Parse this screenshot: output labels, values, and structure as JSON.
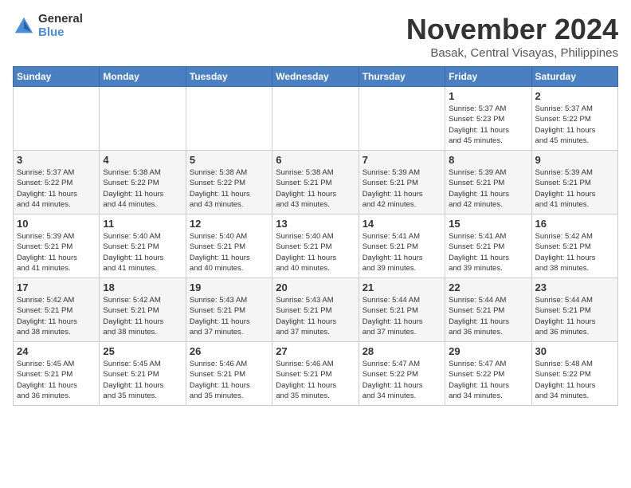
{
  "logo": {
    "general": "General",
    "blue": "Blue"
  },
  "title": "November 2024",
  "location": "Basak, Central Visayas, Philippines",
  "weekdays": [
    "Sunday",
    "Monday",
    "Tuesday",
    "Wednesday",
    "Thursday",
    "Friday",
    "Saturday"
  ],
  "weeks": [
    [
      {
        "day": "",
        "info": ""
      },
      {
        "day": "",
        "info": ""
      },
      {
        "day": "",
        "info": ""
      },
      {
        "day": "",
        "info": ""
      },
      {
        "day": "",
        "info": ""
      },
      {
        "day": "1",
        "info": "Sunrise: 5:37 AM\nSunset: 5:23 PM\nDaylight: 11 hours\nand 45 minutes."
      },
      {
        "day": "2",
        "info": "Sunrise: 5:37 AM\nSunset: 5:22 PM\nDaylight: 11 hours\nand 45 minutes."
      }
    ],
    [
      {
        "day": "3",
        "info": "Sunrise: 5:37 AM\nSunset: 5:22 PM\nDaylight: 11 hours\nand 44 minutes."
      },
      {
        "day": "4",
        "info": "Sunrise: 5:38 AM\nSunset: 5:22 PM\nDaylight: 11 hours\nand 44 minutes."
      },
      {
        "day": "5",
        "info": "Sunrise: 5:38 AM\nSunset: 5:22 PM\nDaylight: 11 hours\nand 43 minutes."
      },
      {
        "day": "6",
        "info": "Sunrise: 5:38 AM\nSunset: 5:21 PM\nDaylight: 11 hours\nand 43 minutes."
      },
      {
        "day": "7",
        "info": "Sunrise: 5:39 AM\nSunset: 5:21 PM\nDaylight: 11 hours\nand 42 minutes."
      },
      {
        "day": "8",
        "info": "Sunrise: 5:39 AM\nSunset: 5:21 PM\nDaylight: 11 hours\nand 42 minutes."
      },
      {
        "day": "9",
        "info": "Sunrise: 5:39 AM\nSunset: 5:21 PM\nDaylight: 11 hours\nand 41 minutes."
      }
    ],
    [
      {
        "day": "10",
        "info": "Sunrise: 5:39 AM\nSunset: 5:21 PM\nDaylight: 11 hours\nand 41 minutes."
      },
      {
        "day": "11",
        "info": "Sunrise: 5:40 AM\nSunset: 5:21 PM\nDaylight: 11 hours\nand 41 minutes."
      },
      {
        "day": "12",
        "info": "Sunrise: 5:40 AM\nSunset: 5:21 PM\nDaylight: 11 hours\nand 40 minutes."
      },
      {
        "day": "13",
        "info": "Sunrise: 5:40 AM\nSunset: 5:21 PM\nDaylight: 11 hours\nand 40 minutes."
      },
      {
        "day": "14",
        "info": "Sunrise: 5:41 AM\nSunset: 5:21 PM\nDaylight: 11 hours\nand 39 minutes."
      },
      {
        "day": "15",
        "info": "Sunrise: 5:41 AM\nSunset: 5:21 PM\nDaylight: 11 hours\nand 39 minutes."
      },
      {
        "day": "16",
        "info": "Sunrise: 5:42 AM\nSunset: 5:21 PM\nDaylight: 11 hours\nand 38 minutes."
      }
    ],
    [
      {
        "day": "17",
        "info": "Sunrise: 5:42 AM\nSunset: 5:21 PM\nDaylight: 11 hours\nand 38 minutes."
      },
      {
        "day": "18",
        "info": "Sunrise: 5:42 AM\nSunset: 5:21 PM\nDaylight: 11 hours\nand 38 minutes."
      },
      {
        "day": "19",
        "info": "Sunrise: 5:43 AM\nSunset: 5:21 PM\nDaylight: 11 hours\nand 37 minutes."
      },
      {
        "day": "20",
        "info": "Sunrise: 5:43 AM\nSunset: 5:21 PM\nDaylight: 11 hours\nand 37 minutes."
      },
      {
        "day": "21",
        "info": "Sunrise: 5:44 AM\nSunset: 5:21 PM\nDaylight: 11 hours\nand 37 minutes."
      },
      {
        "day": "22",
        "info": "Sunrise: 5:44 AM\nSunset: 5:21 PM\nDaylight: 11 hours\nand 36 minutes."
      },
      {
        "day": "23",
        "info": "Sunrise: 5:44 AM\nSunset: 5:21 PM\nDaylight: 11 hours\nand 36 minutes."
      }
    ],
    [
      {
        "day": "24",
        "info": "Sunrise: 5:45 AM\nSunset: 5:21 PM\nDaylight: 11 hours\nand 36 minutes."
      },
      {
        "day": "25",
        "info": "Sunrise: 5:45 AM\nSunset: 5:21 PM\nDaylight: 11 hours\nand 35 minutes."
      },
      {
        "day": "26",
        "info": "Sunrise: 5:46 AM\nSunset: 5:21 PM\nDaylight: 11 hours\nand 35 minutes."
      },
      {
        "day": "27",
        "info": "Sunrise: 5:46 AM\nSunset: 5:21 PM\nDaylight: 11 hours\nand 35 minutes."
      },
      {
        "day": "28",
        "info": "Sunrise: 5:47 AM\nSunset: 5:22 PM\nDaylight: 11 hours\nand 34 minutes."
      },
      {
        "day": "29",
        "info": "Sunrise: 5:47 AM\nSunset: 5:22 PM\nDaylight: 11 hours\nand 34 minutes."
      },
      {
        "day": "30",
        "info": "Sunrise: 5:48 AM\nSunset: 5:22 PM\nDaylight: 11 hours\nand 34 minutes."
      }
    ]
  ]
}
